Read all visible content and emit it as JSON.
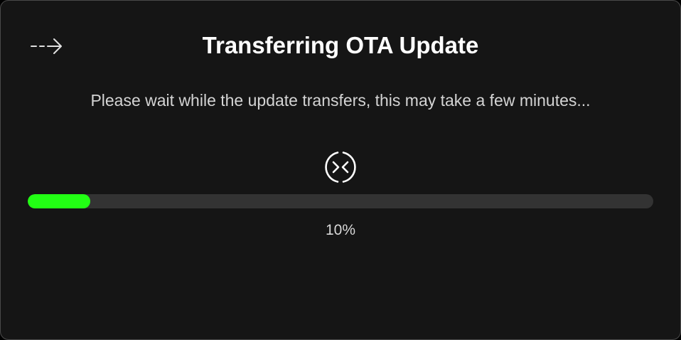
{
  "dialog": {
    "back_icon": "dashed-arrow-right-icon",
    "title": "Transferring OTA Update",
    "message": "Please wait while the update transfers, this may take a few minutes...",
    "status_icon": "sync-circle-icon",
    "progress": {
      "value": 0.1,
      "label": "10%"
    }
  },
  "colors": {
    "background": "#151515",
    "border": "#4a4a4a",
    "track": "#333333",
    "fill": "#22ff14",
    "title": "#ffffff",
    "text": "#d4d4d4"
  }
}
